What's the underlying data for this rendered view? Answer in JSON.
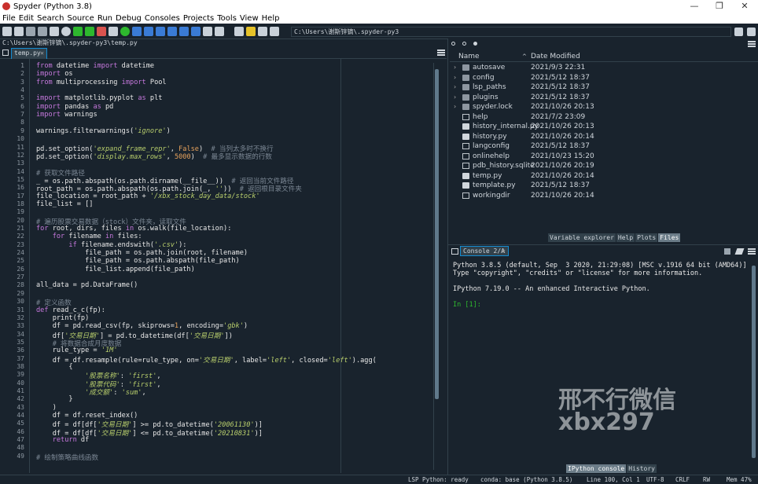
{
  "window": {
    "title": "Spyder (Python 3.8)",
    "controls": [
      "—",
      "❐",
      "✕"
    ]
  },
  "menu": [
    "File",
    "Edit",
    "Search",
    "Source",
    "Run",
    "Debug",
    "Consoles",
    "Projects",
    "Tools",
    "View",
    "Help"
  ],
  "toolbar": {
    "path": "C:\\Users\\谢斯锌镝\\.spyder-py3"
  },
  "editor": {
    "file_path": "C:\\Users\\谢斯锌镝\\.spyder-py3\\temp.py",
    "tab_label": "temp.py",
    "tab_close": "✕",
    "lines": [
      [
        "from datetime import datetime"
      ],
      [
        "import os"
      ],
      [
        "from multiprocessing import Pool"
      ],
      [
        ""
      ],
      [
        "import matplotlib.pyplot as plt"
      ],
      [
        "import pandas as pd"
      ],
      [
        "import warnings"
      ],
      [
        ""
      ],
      [
        "warnings.filterwarnings('ignore')"
      ],
      [
        ""
      ],
      [
        "pd.set_option('expand_frame_repr', False)  # 当列太多时不换行"
      ],
      [
        "pd.set_option('display.max_rows', 5000)  # 最多显示数据的行数"
      ],
      [
        ""
      ],
      [
        "# 获取文件路径"
      ],
      [
        "_ = os.path.abspath(os.path.dirname(__file__))  # 返回当前文件路径"
      ],
      [
        "root_path = os.path.abspath(os.path.join(_, ''))  # 返回根目录文件夹"
      ],
      [
        "file_location = root_path + '/xbx_stock_day_data/stock'"
      ],
      [
        "file_list = []"
      ],
      [
        ""
      ],
      [
        "# 遍历股票交易数据（stock）文件夹，读取文件"
      ],
      [
        "for root, dirs, files in os.walk(file_location):"
      ],
      [
        "    for filename in files:"
      ],
      [
        "        if filename.endswith('.csv'):"
      ],
      [
        "            file_path = os.path.join(root, filename)"
      ],
      [
        "            file_path = os.path.abspath(file_path)"
      ],
      [
        "            file_list.append(file_path)"
      ],
      [
        ""
      ],
      [
        "all_data = pd.DataFrame()"
      ],
      [
        ""
      ],
      [
        "# 定义函数"
      ],
      [
        "def read_c_c(fp):"
      ],
      [
        "    print(fp)"
      ],
      [
        "    df = pd.read_csv(fp, skiprows=1, encoding='gbk')"
      ],
      [
        "    df['交易日期'] = pd.to_datetime(df['交易日期'])"
      ],
      [
        "    # 将数据合成月度数据"
      ],
      [
        "    rule_type = '1M'"
      ],
      [
        "    df = df.resample(rule=rule_type, on='交易日期', label='left', closed='left').agg("
      ],
      [
        "        {"
      ],
      [
        "            '股票名称': 'first',"
      ],
      [
        "            '股票代码': 'first',"
      ],
      [
        "            '成交额': 'sum',"
      ],
      [
        "        }"
      ],
      [
        "    )"
      ],
      [
        "    df = df.reset_index()"
      ],
      [
        "    df = df[df['交易日期'] >= pd.to_datetime('20061130')]"
      ],
      [
        "    df = df[df['交易日期'] <= pd.to_datetime('20210831')]"
      ],
      [
        "    return df"
      ],
      [
        ""
      ],
      [
        "# 绘制策略曲线函数"
      ]
    ]
  },
  "files": {
    "col_name": "Name",
    "col_date": "Date Modified",
    "sort_icon": "^",
    "rows": [
      {
        "name": "autosave",
        "date": "2021/9/3 22:31",
        "type": "folder"
      },
      {
        "name": "config",
        "date": "2021/5/12 18:37",
        "type": "folder"
      },
      {
        "name": "lsp_paths",
        "date": "2021/5/12 18:37",
        "type": "folder"
      },
      {
        "name": "plugins",
        "date": "2021/5/12 18:37",
        "type": "folder"
      },
      {
        "name": "spyder.lock",
        "date": "2021/10/26 20:13",
        "type": "folder"
      },
      {
        "name": "help",
        "date": "2021/7/2 23:09",
        "type": "file"
      },
      {
        "name": "history_internal.py",
        "date": "2021/10/26 20:13",
        "type": "py"
      },
      {
        "name": "history.py",
        "date": "2021/10/26 20:14",
        "type": "py"
      },
      {
        "name": "langconfig",
        "date": "2021/5/12 18:37",
        "type": "file"
      },
      {
        "name": "onlinehelp",
        "date": "2021/10/23 15:20",
        "type": "file"
      },
      {
        "name": "pdb_history.sqlite",
        "date": "2021/10/26 20:19",
        "type": "file"
      },
      {
        "name": "temp.py",
        "date": "2021/10/26 20:14",
        "type": "py"
      },
      {
        "name": "template.py",
        "date": "2021/5/12 18:37",
        "type": "py"
      },
      {
        "name": "workingdir",
        "date": "2021/10/26 20:14",
        "type": "file"
      }
    ]
  },
  "upper_tabs": [
    "Variable explorer",
    "Help",
    "Plots",
    "Files"
  ],
  "console": {
    "tab_label": "Console 2/A",
    "tab_close": "✕",
    "lines": [
      "Python 3.8.5 (default, Sep  3 2020, 21:29:08) [MSC v.1916 64 bit (AMD64)]",
      "Type \"copyright\", \"credits\" or \"license\" for more information.",
      "",
      "IPython 7.19.0 -- An enhanced Interactive Python.",
      ""
    ],
    "prompt": "In [1]:"
  },
  "watermark": {
    "line1": "邢不行微信",
    "line2": "xbx297"
  },
  "lower_tabs": [
    "IPython console",
    "History"
  ],
  "status": {
    "lsp": "LSP Python: ready",
    "conda": "conda: base (Python 3.8.5)",
    "position": "Line 100, Col 1",
    "encoding": "UTF-8",
    "eol": "CRLF",
    "rw": "RW",
    "mem": "Mem 47%"
  },
  "colors": {
    "accent": "#148cd2",
    "background": "#19232d",
    "border": "#32414b"
  }
}
